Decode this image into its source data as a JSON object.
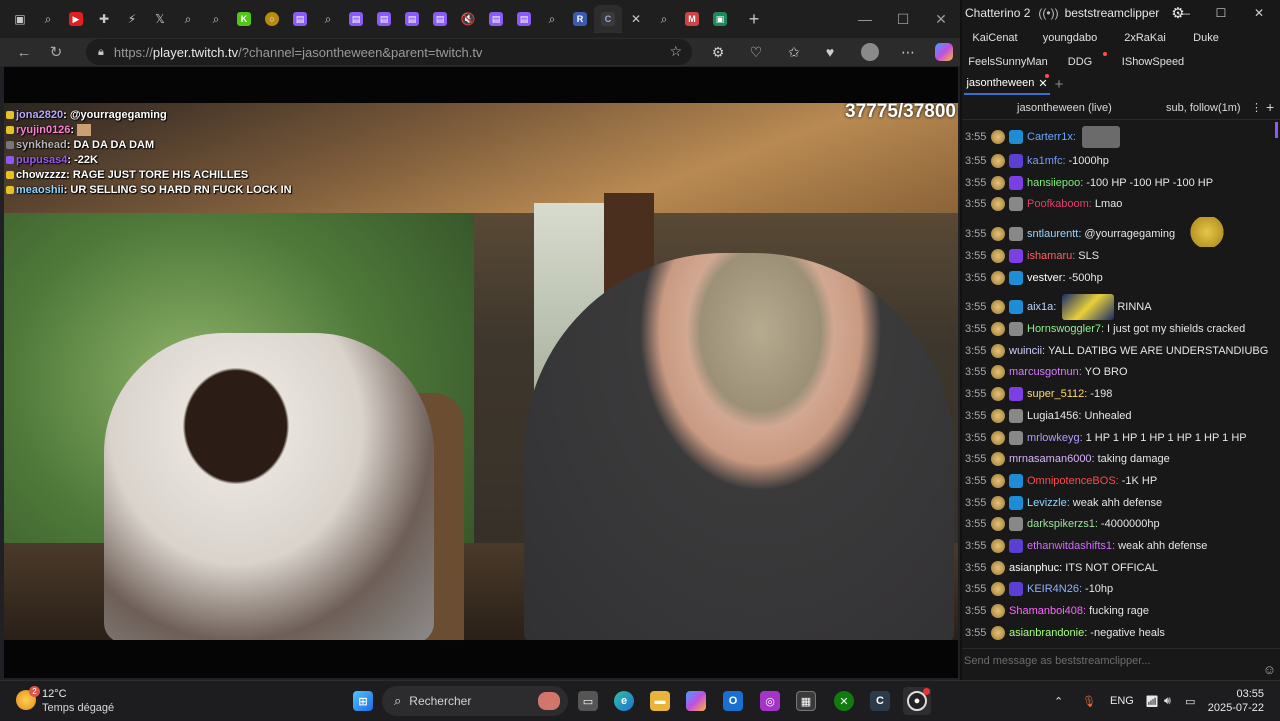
{
  "browser": {
    "url_prefix": "https://",
    "url_host": "player.twitch.tv",
    "url_path": "/?channel=jasontheween&parent=twitch.tv",
    "new_tab_symbol": "+"
  },
  "video": {
    "counter": "37775/37800",
    "overlay_chat": [
      {
        "user": "jona2820",
        "text": ": @yourragegaming",
        "color": "#b9a6ff"
      },
      {
        "user": "ryujin0126",
        "text": ":",
        "color": "#ff7fd0"
      },
      {
        "user": "synkhead",
        "text": ": DA DA DA DAM",
        "color": "#b5b5b5"
      },
      {
        "user": "pupusas4",
        "text": ": -22K",
        "color": "#9b59f0"
      },
      {
        "user": "chowzzzz",
        "text": ": RAGE JUST TORE HIS ACHILLES",
        "color": "#ffffff"
      },
      {
        "user": "meaoshii",
        "text": ": UR SELLING SO HARD RN FUCK LOCK IN",
        "color": "#8fd3ff"
      }
    ]
  },
  "chatterino": {
    "app_name": "Chatterino 2",
    "account": "beststreamclipper",
    "tabs": [
      "KaiCenat",
      "youngdabo",
      "2xRaKai",
      "Duke",
      "FeelsSunnyMan",
      "DDG",
      "IShowSpeed",
      "jasontheween"
    ],
    "active_tab": "jasontheween",
    "channel_title": "jasontheween (live)",
    "channel_mode": "sub, follow(1m)",
    "input_placeholder": "Send message as beststreamclipper...",
    "messages": [
      {
        "ts": "3:55",
        "user": "Carterr1x:",
        "text": "",
        "color": "#6aa6ff",
        "b2": "b-blue"
      },
      {
        "ts": "3:55",
        "user": "ka1mfc:",
        "text": "-1000hp",
        "color": "#7a9bff",
        "b2": "b-tier"
      },
      {
        "ts": "3:55",
        "user": "hansiiepoo:",
        "text": "-100 HP -100 HP -100 HP",
        "color": "#7ef07e",
        "b2": "b-purple"
      },
      {
        "ts": "3:55",
        "user": "Poofkaboom:",
        "text": "Lmao",
        "color": "#e0406a",
        "b2": "b-grey"
      },
      {
        "ts": "3:55",
        "user": "sntlaurentt:",
        "text": "@yourragegaming",
        "color": "#8fd8ff",
        "b2": "b-grey"
      },
      {
        "ts": "3:55",
        "user": "ishamaru:",
        "text": "SLS",
        "color": "#ff5f5f",
        "b2": "b-purple"
      },
      {
        "ts": "3:55",
        "user": "vestver:",
        "text": "-500hp",
        "color": "#ffffff",
        "b2": "b-blue"
      },
      {
        "ts": "3:55",
        "user": "aix1a:",
        "text": "RINNA",
        "color": "#bcd6ff",
        "b2": "b-blue"
      },
      {
        "ts": "3:55",
        "user": "Hornswoggler7:",
        "text": "I just got my shields cracked",
        "color": "#8ef08e",
        "b2": "b-grey"
      },
      {
        "ts": "3:55",
        "user": "wuincii:",
        "text": "YALL DATIBG WE ARE UNDERSTANDIUBG",
        "color": "#cfcfff",
        "b2": ""
      },
      {
        "ts": "3:55",
        "user": "marcusgotnun:",
        "text": "YO BRO",
        "color": "#d97bff",
        "b2": ""
      },
      {
        "ts": "3:55",
        "user": "super_5112:",
        "text": "-198",
        "color": "#ffd966",
        "b2": "b-purple"
      },
      {
        "ts": "3:55",
        "user": "Lugia1456:",
        "text": "Unhealed",
        "color": "#e8e8e8",
        "b2": "b-grey"
      },
      {
        "ts": "3:55",
        "user": "mrlowkeyg:",
        "text": "1 HP 1 HP 1 HP 1 HP 1 HP 1 HP",
        "color": "#b49bff",
        "b2": "b-grey"
      },
      {
        "ts": "3:55",
        "user": "mrnasaman6000:",
        "text": "taking damage",
        "color": "#d8b4ff",
        "b2": ""
      },
      {
        "ts": "3:55",
        "user": "OmnipotenceBOS:",
        "text": "-1K HP",
        "color": "#ff4a4a",
        "b2": "b-blue"
      },
      {
        "ts": "3:55",
        "user": "Levizzle:",
        "text": "weak ahh defense",
        "color": "#8fd8ff",
        "b2": "b-blue"
      },
      {
        "ts": "3:55",
        "user": "darkspikerzs1:",
        "text": "-4000000hp",
        "color": "#9ee0a0",
        "b2": "b-grey"
      },
      {
        "ts": "3:55",
        "user": "ethanwitdashifts1:",
        "text": "weak ahh defense",
        "color": "#d36bff",
        "b2": "b-tier"
      },
      {
        "ts": "3:55",
        "user": "asianphuc:",
        "text": "ITS NOT OFFICAL",
        "color": "#ffffff",
        "b2": ""
      },
      {
        "ts": "3:55",
        "user": "KEIR4N26:",
        "text": "-10hp",
        "color": "#8fb2ff",
        "b2": "b-tier"
      },
      {
        "ts": "3:55",
        "user": "Shamanboi408:",
        "text": "fucking rage",
        "color": "#ff66ff",
        "b2": ""
      },
      {
        "ts": "3:55",
        "user": "asianbrandonie:",
        "text": "-negative heals",
        "color": "#a6ff7e",
        "b2": ""
      }
    ]
  },
  "taskbar": {
    "weather_badge": "2",
    "weather_temp": "12°C",
    "weather_desc": "Temps dégagé",
    "search_placeholder": "Rechercher",
    "lang": "ENG",
    "time": "03:55",
    "date": "2025-07-22"
  },
  "colors": {
    "accent": "#3a6fd1",
    "scroll_thumb": "#8a5cf5"
  }
}
